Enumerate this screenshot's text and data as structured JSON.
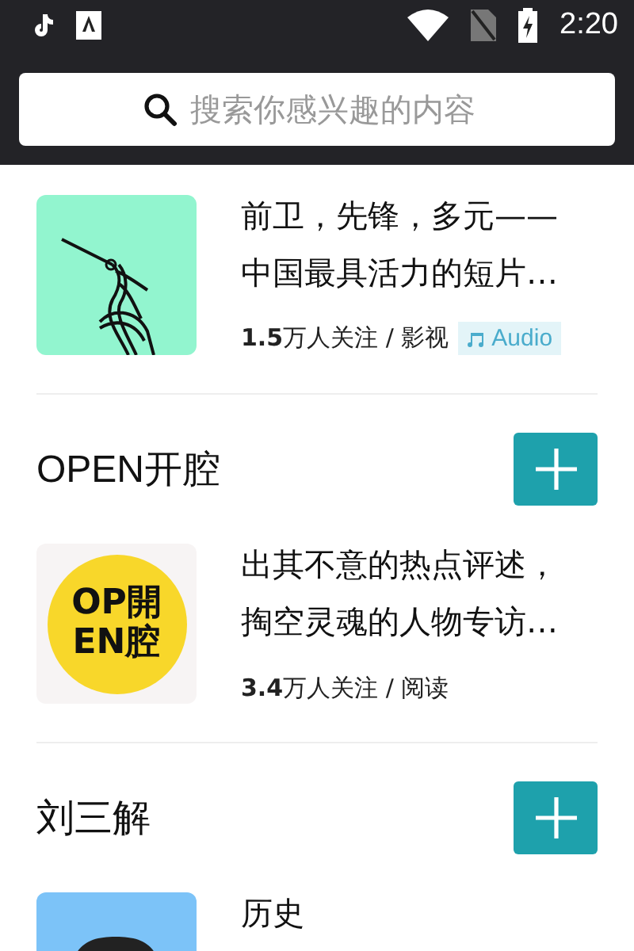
{
  "status_bar": {
    "time": "2:20"
  },
  "search": {
    "placeholder": "搜索你感兴趣的内容"
  },
  "channels": [
    {
      "logo": {
        "kind": "crane"
      },
      "description": "前卫，先锋，多元——中国最具活力的短片…",
      "meta": "**1.5**万人关注 / 影视",
      "tag": "Audio"
    },
    {
      "name": "OPEN开腔",
      "logo": {
        "kind": "text",
        "lines": [
          "OP開",
          "EN腔"
        ]
      },
      "description": "出其不意的热点评述，掏空灵魂的人物专访…",
      "meta": "**3.4**万人关注 / 阅读"
    },
    {
      "name": "刘三解",
      "logo": {
        "kind": "avatar"
      },
      "description": "历史"
    }
  ]
}
